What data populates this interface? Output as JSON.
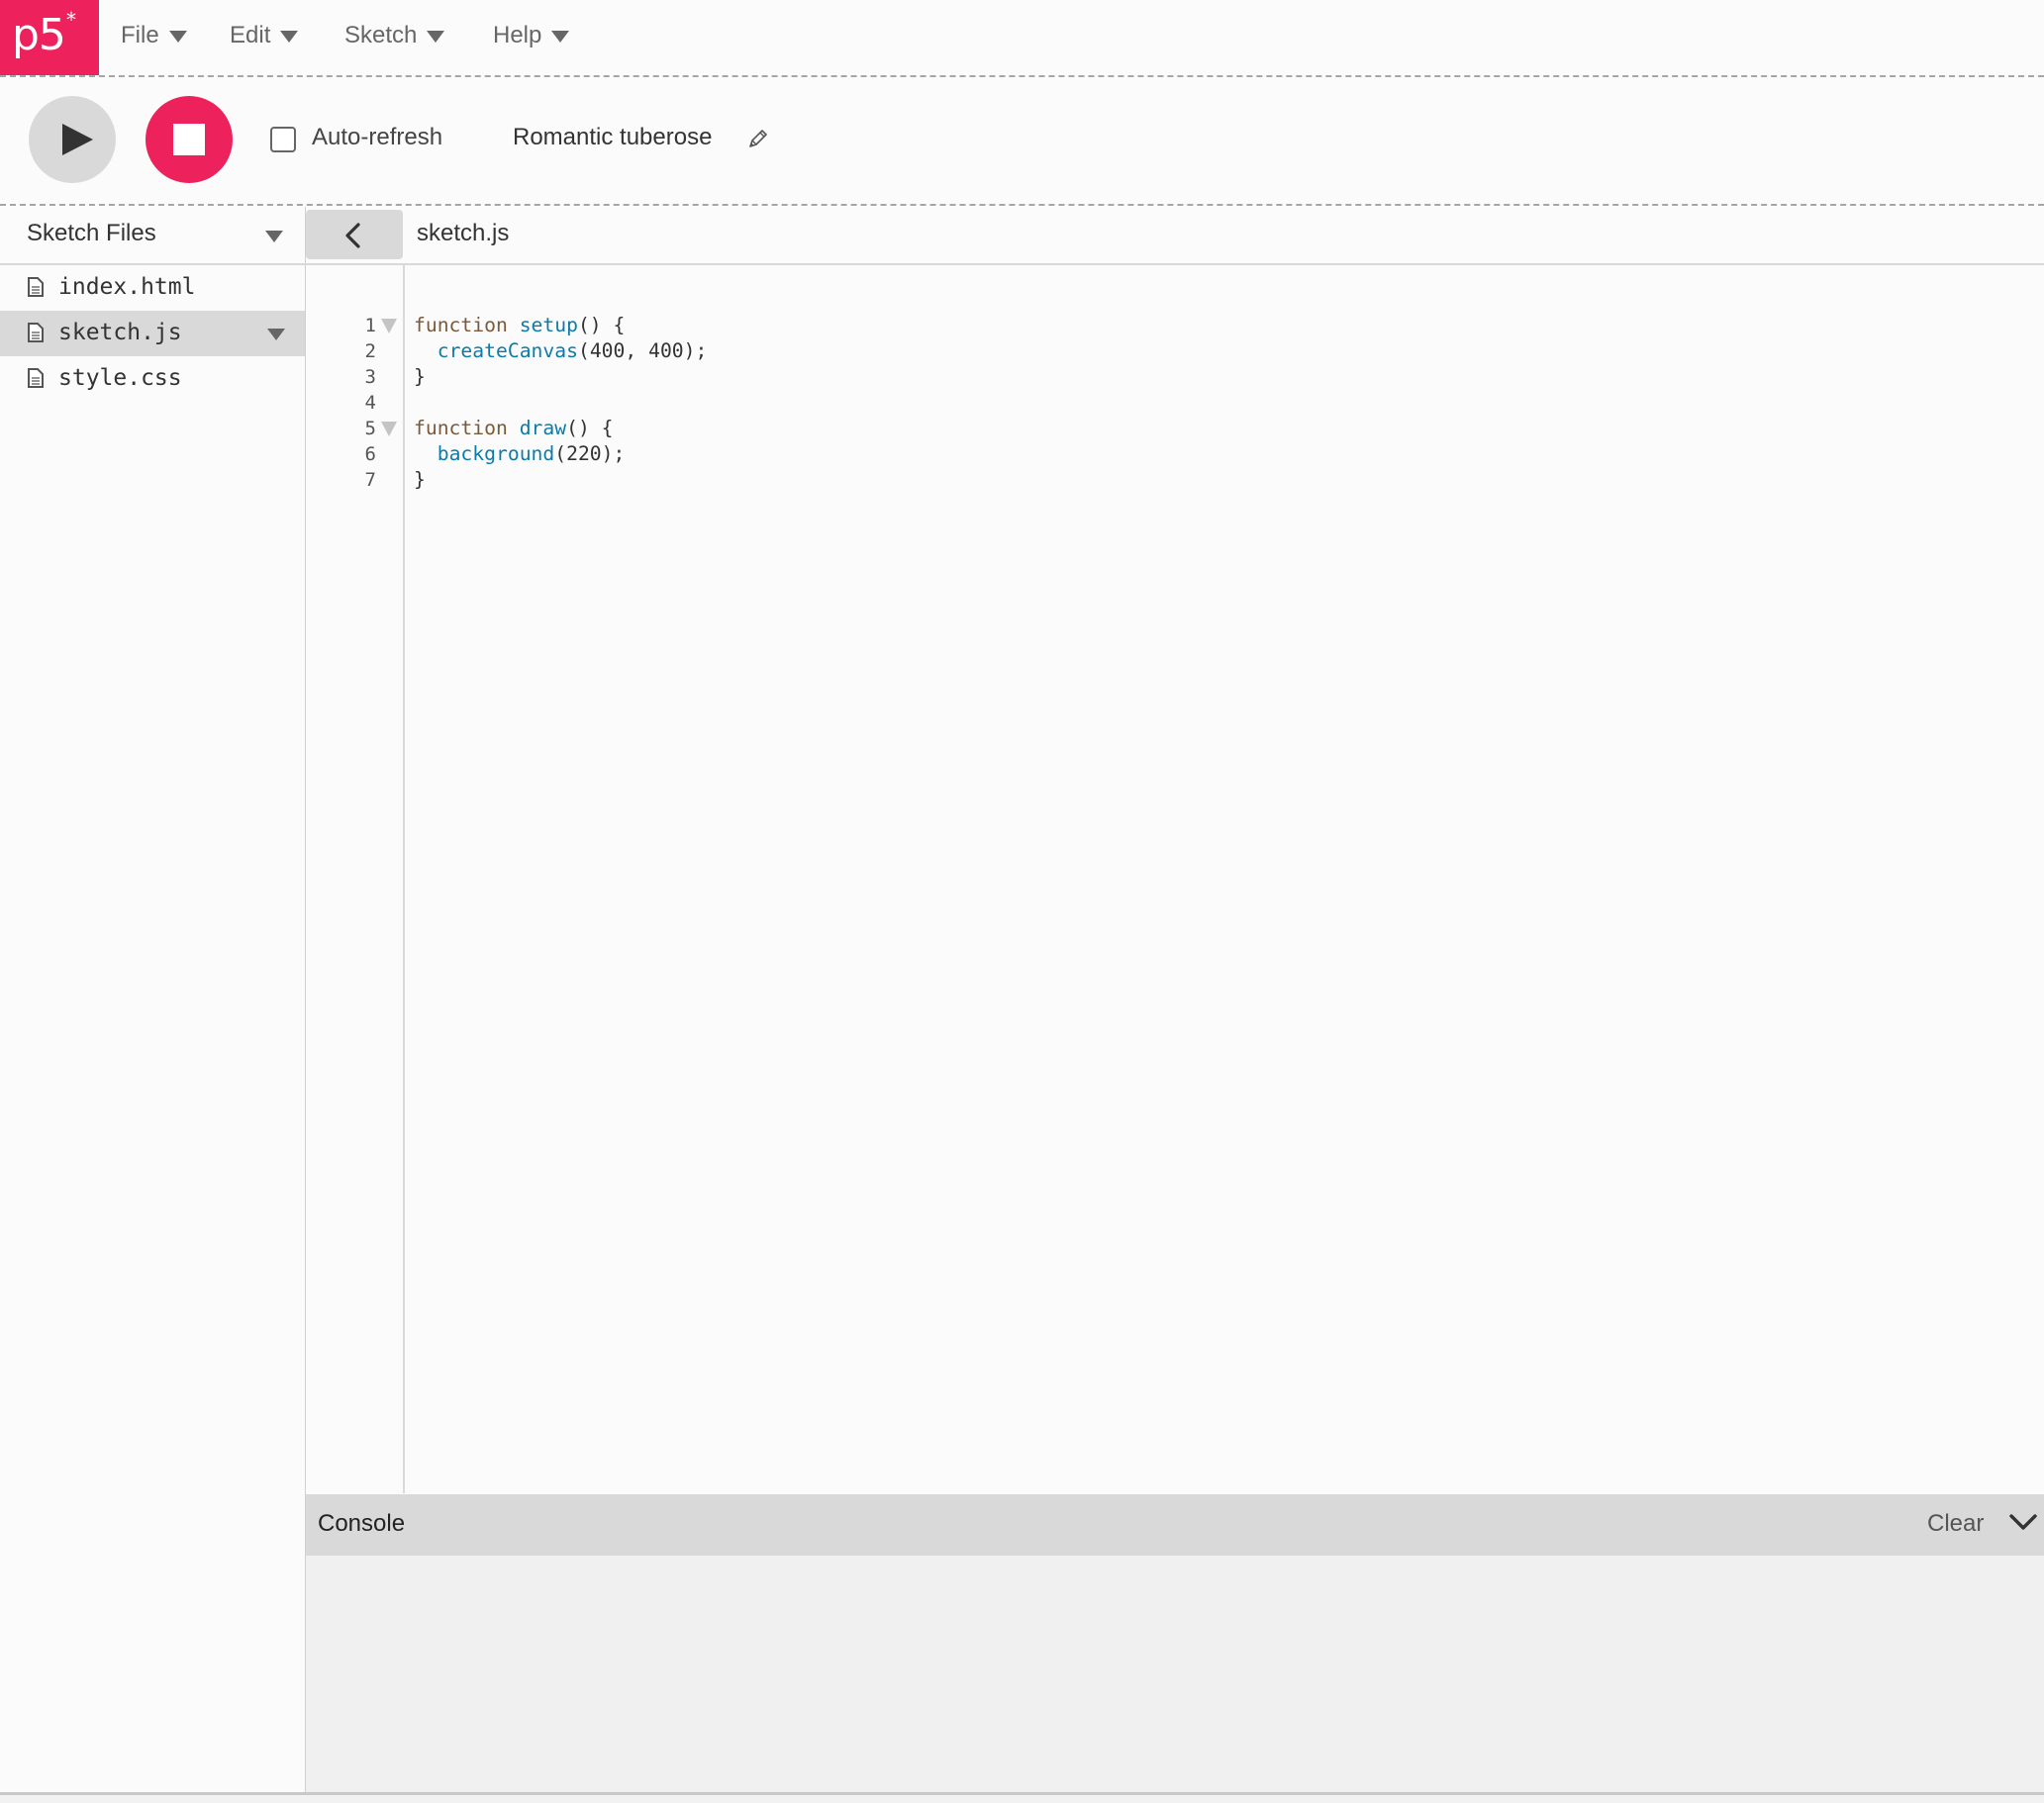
{
  "app": {
    "logo_text": "p5",
    "logo_mark": "*",
    "brand_color": "#ED225D"
  },
  "nav": {
    "menus": [
      {
        "label": "File",
        "icon": "triangle-down-icon"
      },
      {
        "label": "Edit",
        "icon": "triangle-down-icon"
      },
      {
        "label": "Sketch",
        "icon": "triangle-down-icon"
      },
      {
        "label": "Help",
        "icon": "triangle-down-icon"
      }
    ]
  },
  "toolbar": {
    "play_icon": "play-icon",
    "stop_icon": "stop-icon",
    "auto_refresh_label": "Auto-refresh",
    "auto_refresh_checked": false,
    "sketch_name": "Romantic tuberose",
    "edit_name_icon": "pencil-icon"
  },
  "sidebar": {
    "title": "Sketch Files",
    "files": [
      {
        "name": "index.html",
        "selected": false
      },
      {
        "name": "sketch.js",
        "selected": true
      },
      {
        "name": "style.css",
        "selected": false
      }
    ]
  },
  "editor": {
    "collapse_icon": "chevron-left-icon",
    "tab_label": "sketch.js",
    "lines": [
      {
        "num": "1",
        "fold": true,
        "tokens": [
          {
            "t": "function",
            "c": "kw"
          },
          {
            "t": " ",
            "c": "plain"
          },
          {
            "t": "setup",
            "c": "fn"
          },
          {
            "t": "() {",
            "c": "plain"
          }
        ]
      },
      {
        "num": "2",
        "fold": false,
        "tokens": [
          {
            "t": "  ",
            "c": "plain"
          },
          {
            "t": "createCanvas",
            "c": "fn"
          },
          {
            "t": "(400, 400);",
            "c": "plain"
          }
        ]
      },
      {
        "num": "3",
        "fold": false,
        "tokens": [
          {
            "t": "}",
            "c": "plain"
          }
        ]
      },
      {
        "num": "4",
        "fold": false,
        "tokens": []
      },
      {
        "num": "5",
        "fold": true,
        "tokens": [
          {
            "t": "function",
            "c": "kw"
          },
          {
            "t": " ",
            "c": "plain"
          },
          {
            "t": "draw",
            "c": "fn"
          },
          {
            "t": "() {",
            "c": "plain"
          }
        ]
      },
      {
        "num": "6",
        "fold": false,
        "tokens": [
          {
            "t": "  ",
            "c": "plain"
          },
          {
            "t": "background",
            "c": "fn"
          },
          {
            "t": "(220);",
            "c": "plain"
          }
        ]
      },
      {
        "num": "7",
        "fold": false,
        "tokens": [
          {
            "t": "}",
            "c": "plain"
          }
        ]
      }
    ]
  },
  "console": {
    "title": "Console",
    "clear_label": "Clear",
    "collapse_icon": "chevron-down-icon"
  }
}
